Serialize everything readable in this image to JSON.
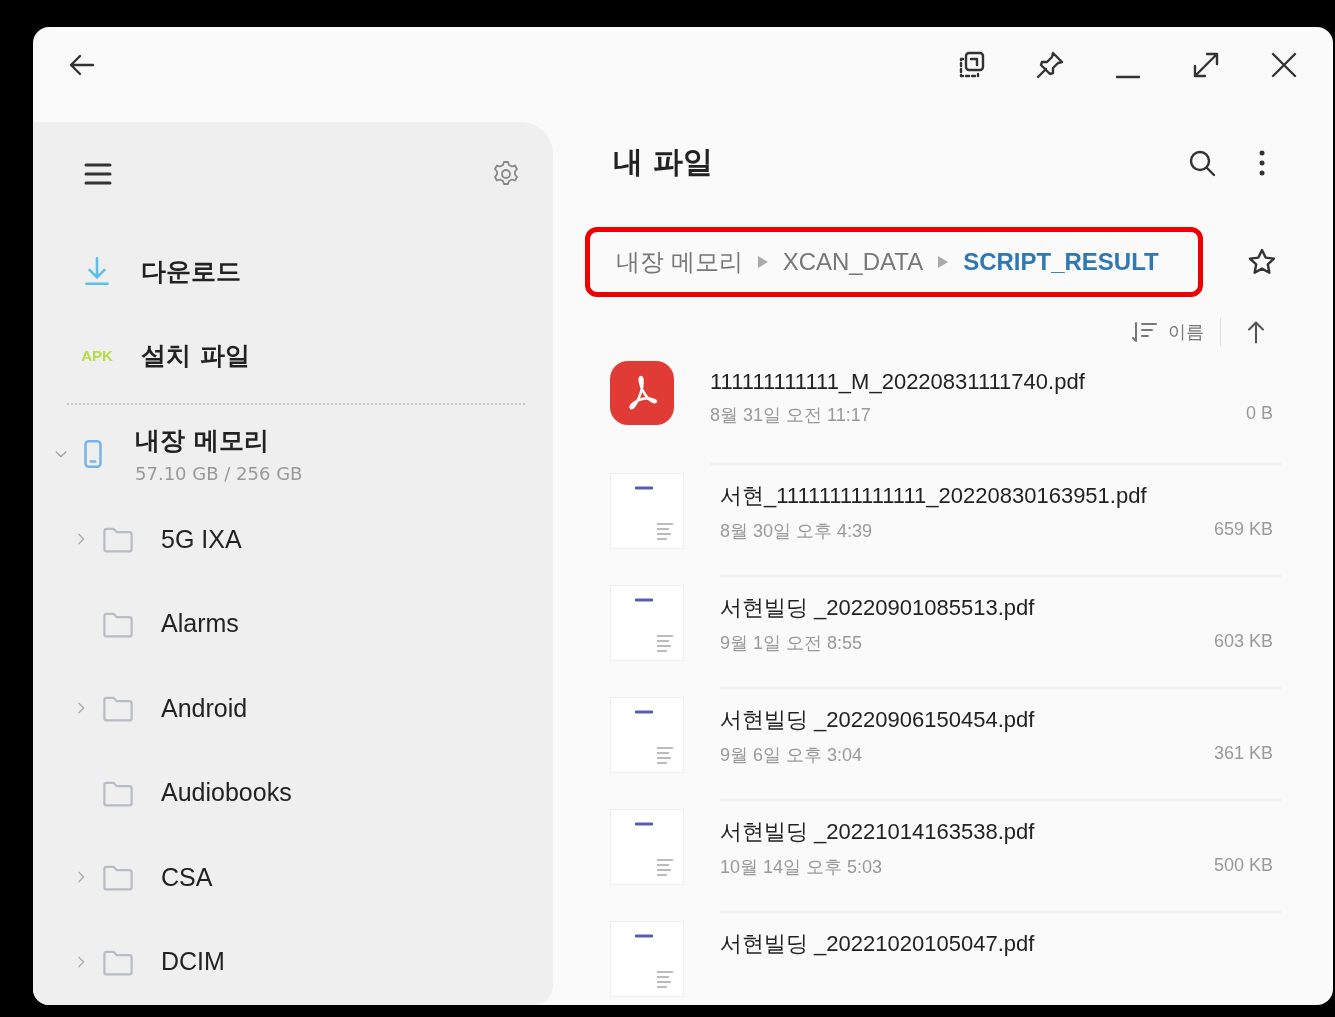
{
  "sidebar": {
    "shortcuts": [
      {
        "kind": "download",
        "label": "다운로드"
      },
      {
        "kind": "apk",
        "badge": "APK",
        "label": "설치 파일"
      }
    ],
    "storage": {
      "name": "내장 메모리",
      "usage": "57.10 GB / 256 GB",
      "expanded": true,
      "children": [
        {
          "name": "5G IXA",
          "expandable": true
        },
        {
          "name": "Alarms",
          "expandable": false
        },
        {
          "name": "Android",
          "expandable": true
        },
        {
          "name": "Audiobooks",
          "expandable": false
        },
        {
          "name": "CSA",
          "expandable": true
        },
        {
          "name": "DCIM",
          "expandable": true
        }
      ]
    }
  },
  "content": {
    "title": "내 파일",
    "breadcrumb": {
      "highlighted": true,
      "items": [
        {
          "label": "내장 메모리",
          "selected": false
        },
        {
          "label": "XCAN_DATA",
          "selected": false
        },
        {
          "label": "SCRIPT_RESULT",
          "selected": true
        }
      ]
    },
    "sort": {
      "label": "이름"
    },
    "files": [
      {
        "kind": "pdf-app",
        "name": "111111111111_M_20220831111740.pdf",
        "date": "8월 31일 오전 11:17",
        "size": "0 B"
      },
      {
        "kind": "thumbnail",
        "name": "서현_11111111111111_20220830163951.pdf",
        "date": "8월 30일 오후 4:39",
        "size": "659 KB"
      },
      {
        "kind": "thumbnail",
        "name": "서현빌딩 _20220901085513.pdf",
        "date": "9월 1일 오전 8:55",
        "size": "603 KB"
      },
      {
        "kind": "thumbnail",
        "name": "서현빌딩 _20220906150454.pdf",
        "date": "9월 6일 오후 3:04",
        "size": "361 KB"
      },
      {
        "kind": "thumbnail",
        "name": "서현빌딩 _20221014163538.pdf",
        "date": "10월 14일 오후 5:03",
        "size": "500 KB"
      },
      {
        "kind": "thumbnail",
        "name": "서현빌딩 _20221020105047.pdf"
      }
    ]
  }
}
